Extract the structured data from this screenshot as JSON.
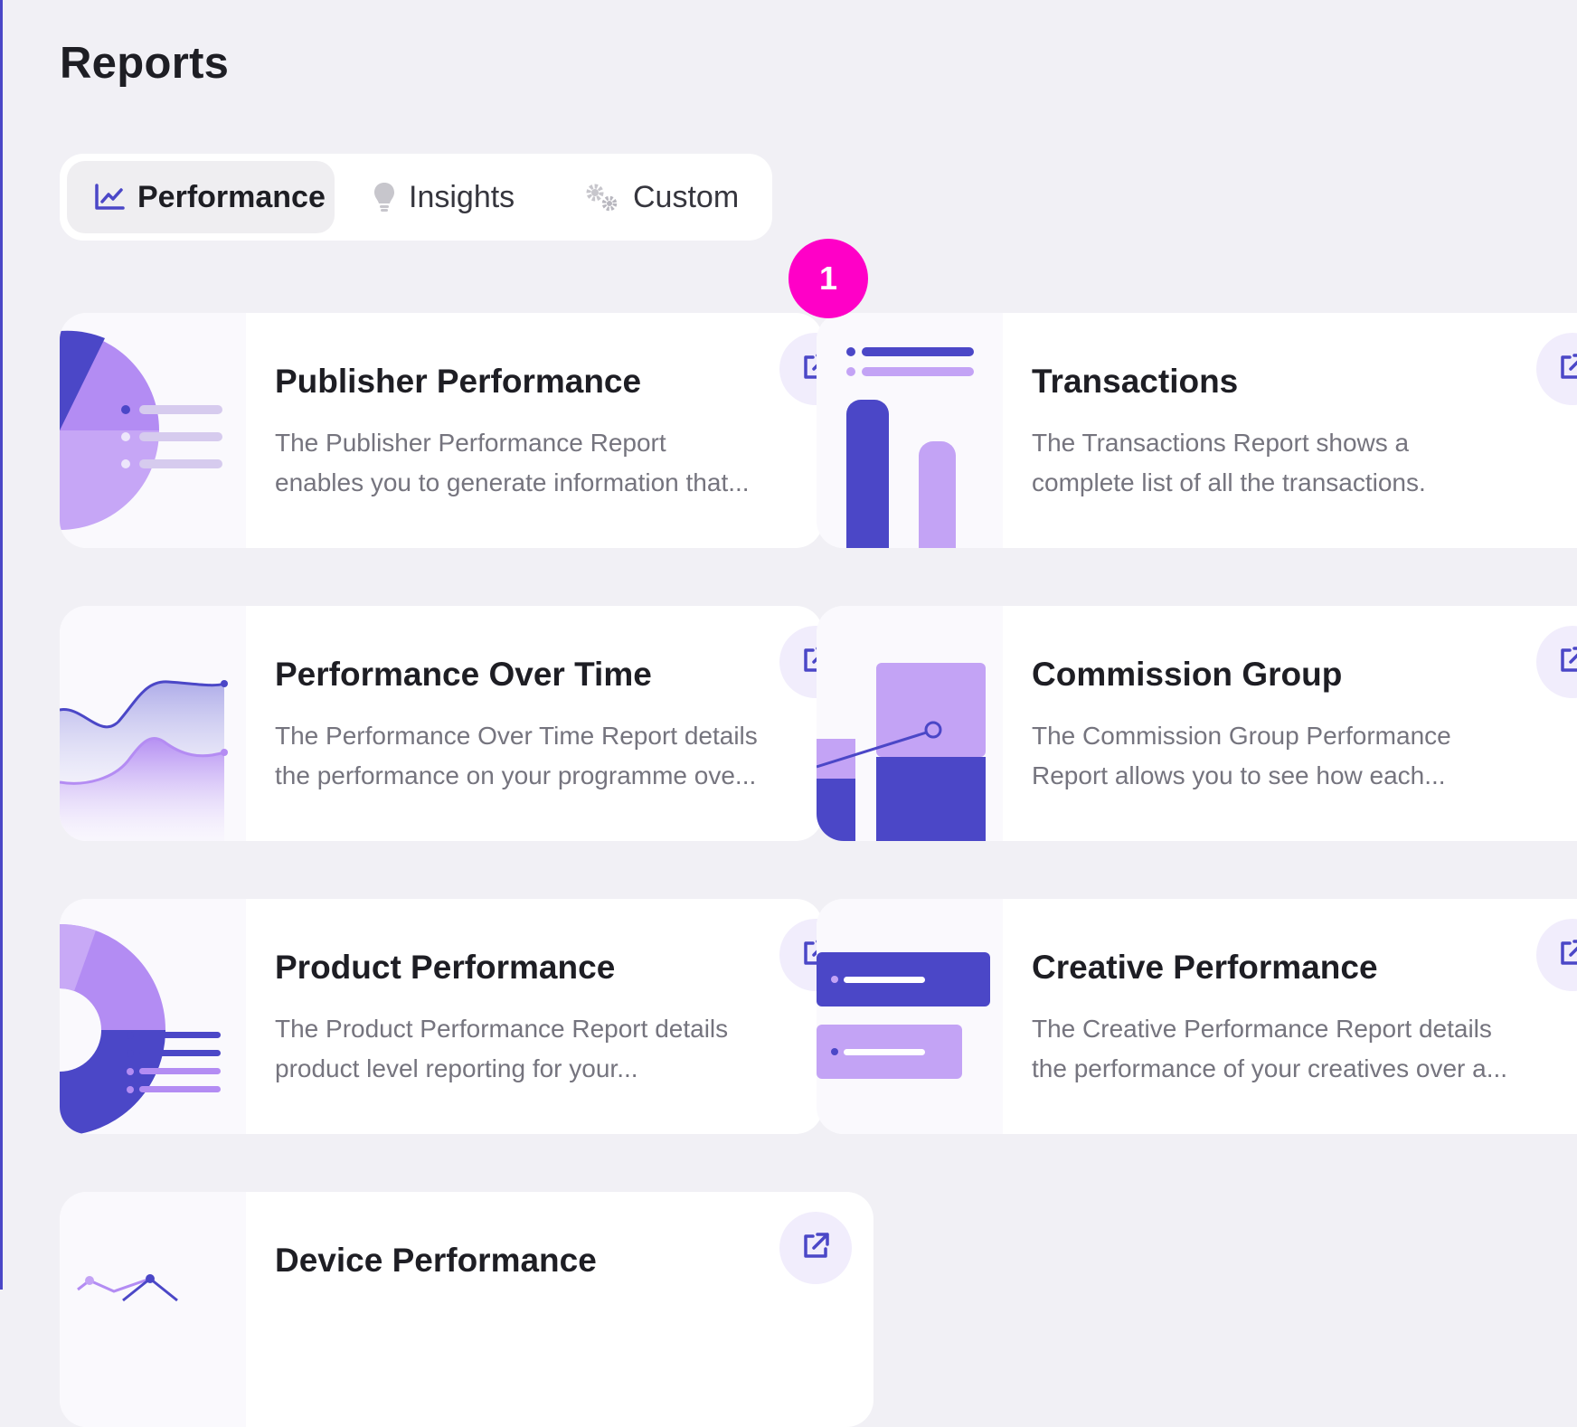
{
  "page": {
    "title": "Reports"
  },
  "tabs": [
    {
      "label": "Performance",
      "icon": "line-chart-icon",
      "active": true
    },
    {
      "label": "Insights",
      "icon": "lightbulb-icon",
      "active": false
    },
    {
      "label": "Custom",
      "icon": "gears-icon",
      "active": false
    }
  ],
  "step_badge": "1",
  "reports": [
    {
      "title": "Publisher Performance",
      "desc_1": "The Publisher Performance Report",
      "desc_2": "enables you to generate information that...",
      "icon": "open-external-icon"
    },
    {
      "title": "Transactions",
      "desc_1": "The Transactions Report shows a",
      "desc_2": "complete list of all the transactions.",
      "icon": "open-external-icon"
    },
    {
      "title": "Performance Over Time",
      "desc_1": "The Performance Over Time Report details",
      "desc_2": "the performance on your programme ove...",
      "icon": "open-external-icon"
    },
    {
      "title": "Commission Group",
      "desc_1": "The Commission Group Performance",
      "desc_2": "Report allows you to see how each...",
      "icon": "open-external-icon"
    },
    {
      "title": "Product Performance",
      "desc_1": "The Product Performance Report details",
      "desc_2": "product level reporting for your...",
      "icon": "open-external-icon"
    },
    {
      "title": "Creative Performance",
      "desc_1": "The Creative Performance Report details",
      "desc_2": "the performance of your creatives over a...",
      "icon": "open-external-icon"
    },
    {
      "title": "Device Performance",
      "desc_1": "",
      "desc_2": "",
      "icon": "open-external-icon"
    }
  ],
  "colors": {
    "accent": "#4b47c7",
    "accent_light": "#c3a3f5",
    "badge": "#ff00c7",
    "background": "#f1f0f5"
  }
}
